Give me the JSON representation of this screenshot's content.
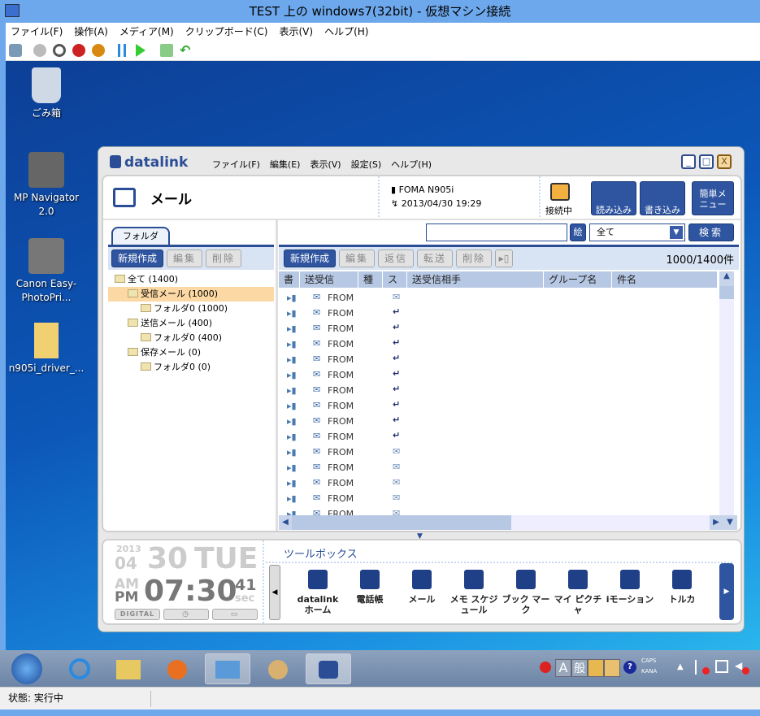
{
  "window": {
    "title": "TEST 上の windows7(32bit)  - 仮想マシン接続"
  },
  "vm_menu": [
    "ファイル(F)",
    "操作(A)",
    "メディア(M)",
    "クリップボード(C)",
    "表示(V)",
    "ヘルプ(H)"
  ],
  "desktop_icons": [
    {
      "label": "ごみ箱"
    },
    {
      "label": "MP Navigator 2.0"
    },
    {
      "label": "Canon Easy-PhotoPri..."
    },
    {
      "label": "n905i_driver_..."
    }
  ],
  "app": {
    "logo": "datalink",
    "menu": [
      "ファイル(F)",
      "編集(E)",
      "表示(V)",
      "設定(S)",
      "ヘルプ(H)"
    ],
    "section_title": "メール",
    "device": "FOMA N905i",
    "datetime": "2013/04/30 19:29",
    "connection_status": "接続中",
    "read_button": "読み込み",
    "write_button": "書き込み",
    "simple_menu": "簡単メニュー",
    "search": {
      "value": "",
      "emoji_button": "絵",
      "filter": "全て",
      "search_button": "検索"
    },
    "folder_tab": "フォルダ",
    "folder_actions": [
      "新規作成",
      "編集",
      "削除"
    ],
    "folders": [
      {
        "label": "全て (1400)",
        "level": 0
      },
      {
        "label": "受信メール (1000)",
        "level": 1,
        "selected": true
      },
      {
        "label": "フォルダ0 (1000)",
        "level": 2
      },
      {
        "label": "送信メール (400)",
        "level": 1
      },
      {
        "label": "フォルダ0 (400)",
        "level": 2
      },
      {
        "label": "保存メール (0)",
        "level": 1
      },
      {
        "label": "フォルダ0 (0)",
        "level": 2
      }
    ],
    "list_actions": [
      "新規作成",
      "編集",
      "返信",
      "転送",
      "削除"
    ],
    "count": "1000/1400件",
    "columns": [
      "書",
      "送受信",
      "種",
      "ス",
      "送受信相手",
      "グループ名",
      "件名"
    ],
    "rows": [
      {
        "dir": "FROM",
        "status": "read"
      },
      {
        "dir": "FROM",
        "status": "replied"
      },
      {
        "dir": "FROM",
        "status": "replied"
      },
      {
        "dir": "FROM",
        "status": "replied"
      },
      {
        "dir": "FROM",
        "status": "replied"
      },
      {
        "dir": "FROM",
        "status": "replied"
      },
      {
        "dir": "FROM",
        "status": "replied"
      },
      {
        "dir": "FROM",
        "status": "replied"
      },
      {
        "dir": "FROM",
        "status": "replied"
      },
      {
        "dir": "FROM",
        "status": "replied"
      },
      {
        "dir": "FROM",
        "status": "read"
      },
      {
        "dir": "FROM",
        "status": "read"
      },
      {
        "dir": "FROM",
        "status": "read"
      },
      {
        "dir": "FROM",
        "status": "read"
      },
      {
        "dir": "FROM",
        "status": "read"
      }
    ],
    "clock": {
      "year": "2013",
      "month": "04",
      "day": "30",
      "weekday": "TUE",
      "am": "AM",
      "pm": "PM",
      "time": "07:30",
      "sec": "41",
      "sec_label": "sec",
      "mode_digital": "DIGITAL"
    },
    "toolbox": {
      "title": "ツールボックス",
      "tools": [
        "datalink ホーム",
        "電話帳",
        "メール",
        "メモ スケジュール",
        "ブック マーク",
        "マイ ピクチャ",
        "iモーション",
        "トルカ"
      ]
    }
  },
  "tray": {
    "ime_a": "A",
    "ime_mode": "般",
    "caps": "CAPS",
    "kana": "KANA"
  },
  "status": {
    "text": "状態: 実行中"
  }
}
